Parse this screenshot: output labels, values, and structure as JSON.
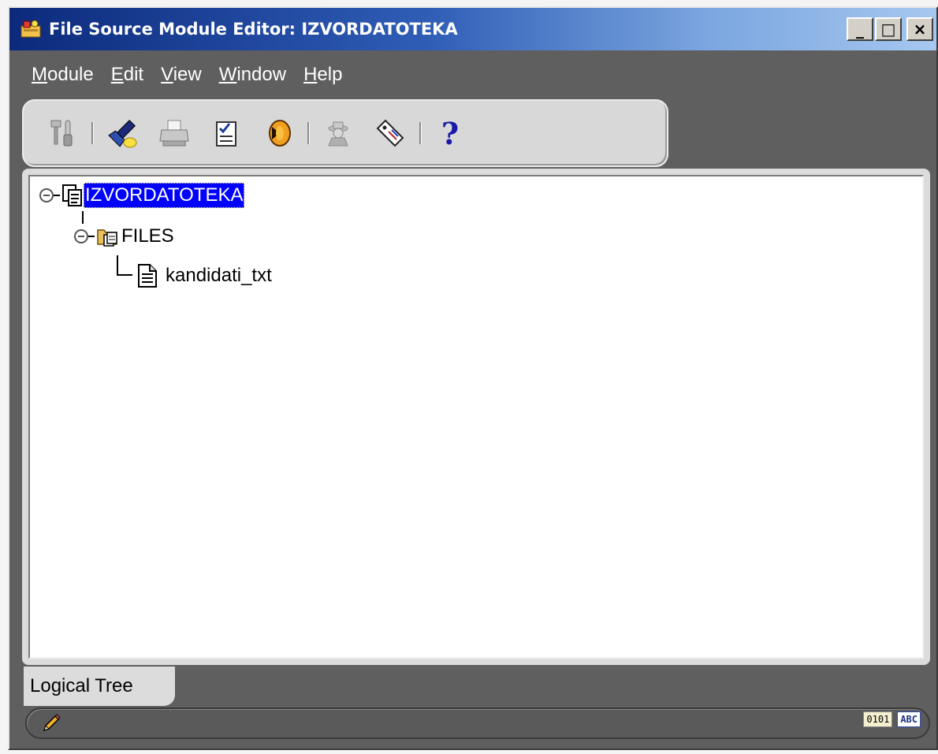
{
  "window": {
    "title": "File Source Module Editor: IZVORDATOTEKA",
    "controls": {
      "minimize": "_",
      "maximize": "□",
      "close": "×"
    }
  },
  "menubar": {
    "items": [
      {
        "mnemonic": "M",
        "rest": "odule"
      },
      {
        "mnemonic": "E",
        "rest": "dit"
      },
      {
        "mnemonic": "V",
        "rest": "iew"
      },
      {
        "mnemonic": "W",
        "rest": "indow"
      },
      {
        "mnemonic": "H",
        "rest": "elp"
      }
    ]
  },
  "toolbar": {
    "buttons": [
      {
        "icon": "tools-icon"
      },
      {
        "icon": "flashlight-icon"
      },
      {
        "icon": "printer-icon"
      },
      {
        "icon": "checklist-icon"
      },
      {
        "icon": "transfer-icon"
      },
      {
        "icon": "agent-icon"
      },
      {
        "icon": "tag-icon"
      },
      {
        "icon": "help-icon",
        "glyph": "?"
      }
    ]
  },
  "tree": {
    "root": {
      "label": "IZVORDATOTEKA",
      "selected": true
    },
    "folder": {
      "label": "FILES"
    },
    "file": {
      "label": "kandidati_txt"
    }
  },
  "tabs": {
    "logical_tree": "Logical Tree"
  },
  "statusbar": {
    "left_icon": "pencil-icon",
    "right_icons": [
      "binary-mode-icon",
      "text-mode-icon"
    ],
    "binary_glyph": "0101",
    "text_glyph": "ABC"
  }
}
